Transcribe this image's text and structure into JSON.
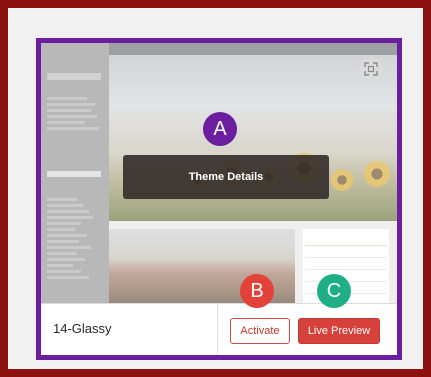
{
  "card": {
    "theme_name": "14-Glassy",
    "theme_details_label": "Theme Details",
    "activate_label": "Activate",
    "live_preview_label": "Live Preview"
  },
  "markers": {
    "a": "A",
    "b": "B",
    "c": "C"
  },
  "colors": {
    "frame": "#8b1010",
    "card_border": "#6b1fa0",
    "marker_a": "#6b1fa0",
    "marker_b": "#e2423a",
    "marker_c": "#1fae86",
    "live_preview_bg": "#d6413b"
  },
  "icons": {
    "expand": "expand-icon"
  }
}
